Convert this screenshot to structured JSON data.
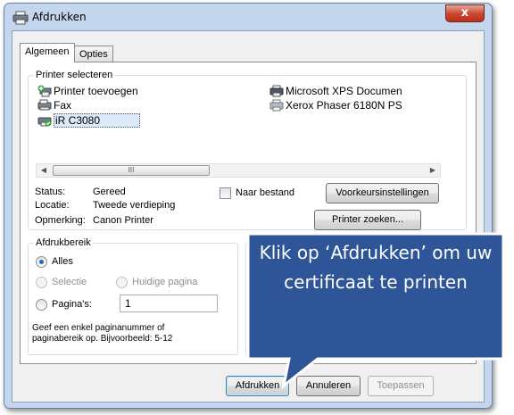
{
  "window": {
    "title": "Afdrukken",
    "close_label": "x"
  },
  "tabs": [
    {
      "label": "Algemeen",
      "active": true
    },
    {
      "label": "Opties",
      "active": false
    }
  ],
  "printer_group": {
    "label": "Printer selecteren",
    "printers": [
      {
        "name": "Printer toevoegen",
        "icon": "add-printer-icon"
      },
      {
        "name": "Fax",
        "icon": "fax-icon"
      },
      {
        "name": "iR C3080",
        "icon": "printer-icon",
        "selected": true
      },
      {
        "name": "Microsoft XPS Documen",
        "icon": "printer-icon"
      },
      {
        "name": "Xerox Phaser 6180N PS",
        "icon": "printer-icon"
      }
    ],
    "scroll_grip": "III",
    "status_label": "Status:",
    "status_value": "Gereed",
    "location_label": "Locatie:",
    "location_value": "Tweede verdieping",
    "comment_label": "Opmerking:",
    "comment_value": "Canon Printer",
    "to_file_label": "Naar bestand",
    "preferences_button": "Voorkeursinstellingen",
    "find_printer_button": "Printer zoeken..."
  },
  "range_group": {
    "label": "Afdrukbereik",
    "all_label": "Alles",
    "selection_label": "Selectie",
    "current_page_label": "Huidige pagina",
    "pages_label": "Pagina's:",
    "pages_value": "1",
    "hint": "Geef een enkel paginanummer of paginabereik op. Bijvoorbeeld: 5-12"
  },
  "buttons": {
    "print": "Afdrukken",
    "cancel": "Annuleren",
    "apply": "Toepassen"
  },
  "callout": {
    "text": "Klik op ‘Afdrukken’ om uw certificaat te printen",
    "fill": "#2e5597",
    "stroke": "#ffffff"
  }
}
